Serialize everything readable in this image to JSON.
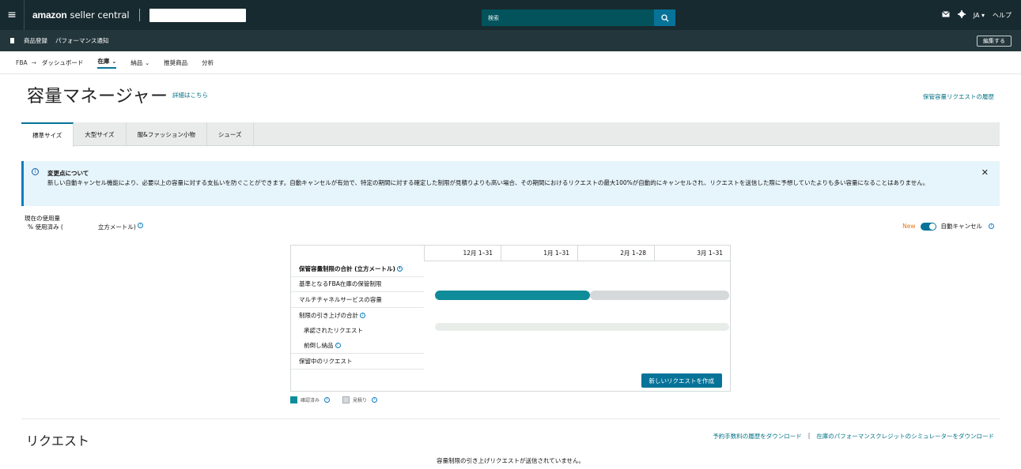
{
  "topbar": {
    "logo_brand": "amazon",
    "logo_product": "seller central",
    "search_placeholder": "検索",
    "language": "JA",
    "help": "ヘルプ"
  },
  "secondary_bar": {
    "links": [
      "商品登録",
      "パフォーマンス通知"
    ],
    "edit_label": "編集する"
  },
  "nav": {
    "crumb": "FBA",
    "arrow": "→",
    "items": [
      {
        "label": "ダッシュボード"
      },
      {
        "label": "在庫"
      },
      {
        "label": "納品"
      },
      {
        "label": "推奨商品"
      },
      {
        "label": "分析"
      }
    ]
  },
  "page": {
    "title": "容量マネージャー",
    "learn_more": "詳細はこちら",
    "history_link": "保管容量リクエストの履歴"
  },
  "tabs": [
    "標準サイズ",
    "大型サイズ",
    "服&ファッション小物",
    "シューズ"
  ],
  "alert": {
    "title": "変更点について",
    "body": "新しい自動キャンセル機能により、必要以上の容量に対する支払いを防ぐことができます。自動キャンセルが有効で、特定の期間に対する確定した制限が見積りよりも高い場合、その期間におけるリクエストの最大100%が自動的にキャンセルされ、リクエストを送信した際に予想していたよりも多い容量になることはありません。"
  },
  "usage": {
    "label": "現在の使用量",
    "percent_label": "% 使用済み (",
    "unit_label": "立方メートル)"
  },
  "autocancel": {
    "new_tag": "New",
    "label": "自動キャンセル"
  },
  "capacity_table": {
    "months": [
      "12月 1–31",
      "1月 1–31",
      "2月 1–28",
      "3月 1–31"
    ],
    "rows": [
      {
        "label": "保管容量制限の合計 (立方メートル)"
      },
      {
        "label": "基準となるFBA在庫の保管制限"
      },
      {
        "label": "マルチチャネルサービスの容量"
      },
      {
        "label": "制限の引き上げの合計"
      },
      {
        "label": "承認されたリクエスト"
      },
      {
        "label": "前倒し納品"
      },
      {
        "label": "保留中のリクエスト"
      }
    ],
    "create_button": "新しいリクエストを作成"
  },
  "legend": {
    "confirmed": "確認済み",
    "estimate": "見積り",
    "confirmed_color": "#0f8c99",
    "estimate_color": "#d5d9d9"
  },
  "requests": {
    "title": "リクエスト",
    "download_fees": "予約手数料の履歴をダウンロード",
    "separator": "|",
    "download_simulator": "在庫のパフォーマンスクレジットのシミュレーターをダウンロード",
    "empty_message": "容量制限の引き上げリクエストが送信されていません。"
  }
}
